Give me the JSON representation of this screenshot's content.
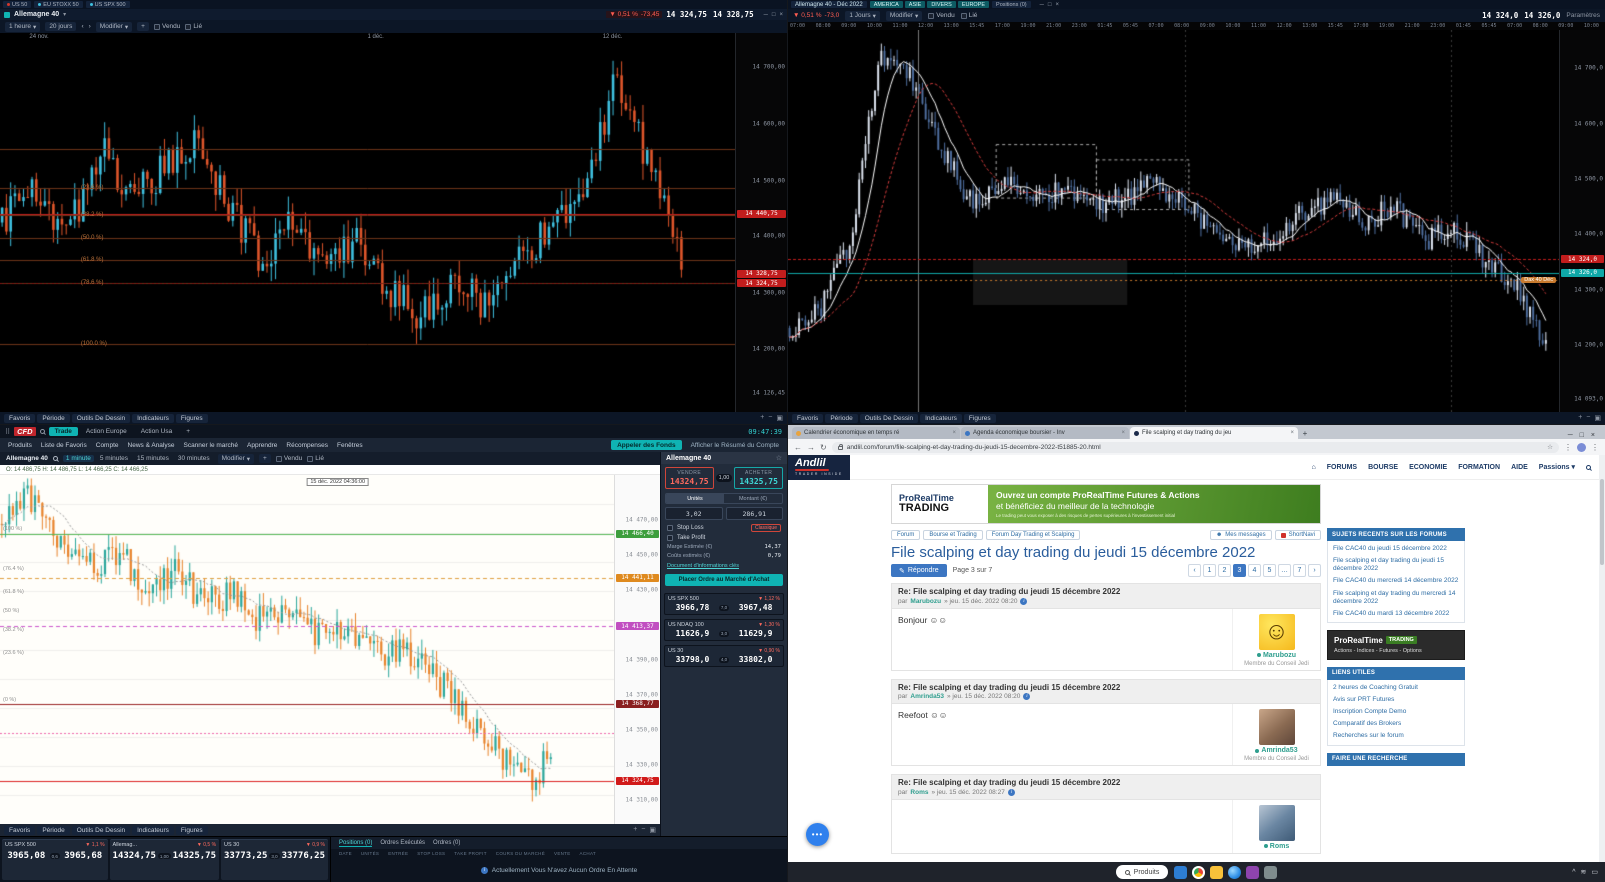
{
  "tl": {
    "workspace_tabs": [
      {
        "label": "US 50"
      },
      {
        "label": "EU STOXX 50"
      },
      {
        "label": "US SPX 500"
      }
    ],
    "title": "Allemagne 40",
    "change_pct": "▼ 0,51 %",
    "change_abs": "-73,45",
    "bid": "14 324,75",
    "ask": "14 328,75",
    "toolbar": {
      "timeframe": "1 heure",
      "range": "20 jours",
      "modify": "Modifier",
      "plus": "+",
      "sell": "Vendu",
      "link": "Lié"
    },
    "dates": [
      {
        "t": "24 nov.",
        "f": 0.04
      },
      {
        "t": "1 déc.",
        "f": 0.5
      },
      {
        "t": "12 déc.",
        "f": 0.82
      }
    ],
    "axis": [
      {
        "t": "14 700,00",
        "f": 0.09
      },
      {
        "t": "14 600,00",
        "f": 0.24
      },
      {
        "t": "14 500,00",
        "f": 0.39
      },
      {
        "t": "14 400,00",
        "f": 0.535
      },
      {
        "t": "14 300,00",
        "f": 0.685
      },
      {
        "t": "14 200,00",
        "f": 0.835
      },
      {
        "t": "14 126,45",
        "f": 0.95
      }
    ],
    "markers": [
      {
        "t": "14 440,75",
        "f": 0.477,
        "color": "#c21d1d"
      },
      {
        "t": "14 328,75",
        "f": 0.635,
        "color": "#c21d1d"
      },
      {
        "t": "14 324,75",
        "f": 0.66,
        "color": "#c21d1d"
      }
    ],
    "fibs": [
      {
        "t": "(23.6 %)",
        "f": 0.41
      },
      {
        "t": "(38.2 %)",
        "f": 0.48
      },
      {
        "t": "(50.0 %)",
        "f": 0.54
      },
      {
        "t": "(61.8 %)",
        "f": 0.6
      },
      {
        "t": "(78.6 %)",
        "f": 0.66
      },
      {
        "t": "(100.0 %)",
        "f": 0.82
      }
    ],
    "bottom_tabs": [
      "Favoris",
      "Période",
      "Outils De Dessin",
      "Indicateurs",
      "Figures"
    ]
  },
  "tr": {
    "title": "Allemagne 40 - Déc 2022",
    "groups": [
      "AMERICA",
      "ASIE",
      "DIVERS",
      "EUROPE"
    ],
    "positions": "Positions (0)",
    "change_pct": "▼ 0,51 %",
    "change_abs": "-73,0",
    "timeframe": "1 Jours",
    "modify": "Modifier",
    "sell": "Vendu",
    "link": "Lié",
    "bid": "14 324,0",
    "ask": "14 326,0",
    "settings": "Paramètres",
    "times": [
      "07:00",
      "08:00",
      "09:00",
      "10:00",
      "11:00",
      "12:00",
      "13:00",
      "15:45",
      "17:00",
      "19:00",
      "21:00",
      "23:00",
      "01:45",
      "05:45",
      "07:00",
      "08:00",
      "09:00",
      "10:00",
      "11:00",
      "12:00",
      "13:00",
      "15:45",
      "17:00",
      "19:00",
      "21:00",
      "23:00",
      "01:45",
      "05:45",
      "07:00",
      "08:00",
      "09:00",
      "10:00"
    ],
    "axis": [
      {
        "t": "14 700,0",
        "f": 0.1
      },
      {
        "t": "14 600,0",
        "f": 0.245
      },
      {
        "t": "14 500,0",
        "f": 0.39
      },
      {
        "t": "14 400,0",
        "f": 0.535
      },
      {
        "t": "14 300,0",
        "f": 0.68
      },
      {
        "t": "14 200,0",
        "f": 0.825
      },
      {
        "t": "14 093,0",
        "f": 0.965
      }
    ],
    "markers": [
      {
        "t": "14 324,0",
        "f": 0.6,
        "color": "#c21d1d"
      },
      {
        "t": "14 326,0",
        "f": 0.635,
        "color": "#0fa8a8"
      }
    ],
    "tag": {
      "t": "Dax 40 Déc",
      "f": 0.655
    },
    "bottom_tabs": [
      "Favoris",
      "Période",
      "Outils De Dessin",
      "Indicateurs",
      "Figures"
    ]
  },
  "bl": {
    "brand": "CFD",
    "clock": "09:47:39",
    "tabs": [
      {
        "label": "Trade",
        "active": true
      },
      {
        "label": "Action Europe"
      },
      {
        "label": "Action Usa"
      },
      {
        "label": "+"
      }
    ],
    "menu": [
      "Produits",
      "Liste de Favoris",
      "Compte",
      "News & Analyse",
      "Scanner le marché",
      "Apprendre",
      "Récompenses",
      "Fenêtres"
    ],
    "fund_btn": "Appeler des Fonds",
    "account_link": "Afficher le Résumé du Compte",
    "instrument": "Allemagne 40",
    "timeframes": [
      "1 minute",
      "5 minutes",
      "15 minutes",
      "30 minutes"
    ],
    "toolbar": {
      "modify": "Modifier",
      "plus": "+",
      "sell": "Vendu",
      "link": "Lié"
    },
    "ohlc": "O: 14 486,75   H: 14 486,75   L: 14 466,25   C: 14 466,25",
    "chart_date": "15 déc. 2022 04:36:00",
    "fibs": [
      {
        "t": "(100 %)",
        "f": 0.155
      },
      {
        "t": "(76.4 %)",
        "f": 0.27
      },
      {
        "t": "(61.8 %)",
        "f": 0.335
      },
      {
        "t": "(50 %)",
        "f": 0.39
      },
      {
        "t": "(38.2 %)",
        "f": 0.445
      },
      {
        "t": "(23.6 %)",
        "f": 0.51
      },
      {
        "t": "(0 %)",
        "f": 0.645
      }
    ],
    "scale": [
      {
        "t": "14 470,00",
        "f": 0.13
      },
      {
        "t": "14 450,00",
        "f": 0.23
      },
      {
        "t": "14 430,00",
        "f": 0.33
      },
      {
        "t": "14 410,00",
        "f": 0.43
      },
      {
        "t": "14 390,00",
        "f": 0.53
      },
      {
        "t": "14 370,00",
        "f": 0.63
      },
      {
        "t": "14 350,00",
        "f": 0.73
      },
      {
        "t": "14 330,00",
        "f": 0.83
      },
      {
        "t": "14 310,00",
        "f": 0.93
      }
    ],
    "markers": [
      {
        "t": "14 466,40",
        "f": 0.168,
        "color": "#3d9e3d"
      },
      {
        "t": "14 441,11",
        "f": 0.294,
        "color": "#df8a1f"
      },
      {
        "t": "14 413,37",
        "f": 0.433,
        "color": "#c14fc1"
      },
      {
        "t": "14 368,77",
        "f": 0.656,
        "color": "#8a1f1f"
      },
      {
        "t": "14 324,75",
        "f": 0.876,
        "color": "#d11a1a"
      }
    ],
    "order": {
      "title": "Allemagne 40",
      "sell_label": "VENDRE",
      "buy_label": "ACHETER",
      "sell": "14324,75",
      "buy": "14325,75",
      "spread": "1,00",
      "unit_tabs": [
        "Unités",
        "Montant (€)"
      ],
      "qty": "3,02",
      "notional": "286,91",
      "stop_loss": "Stop Loss",
      "sl_mode": "Classique",
      "take_profit": "Take Profit",
      "margin_label": "Marge Estimée (€)",
      "margin": "14,37",
      "costs_label": "Coûts estimés (€)",
      "costs": "0,79",
      "kid": "Document d'informations clés",
      "cta": "Placer Ordre au Marché d'Achat"
    },
    "panel_tiles": [
      {
        "name": "US SPX 500",
        "pct": "▼ 1,12 %",
        "spread": "7,0",
        "sell": "3966,78",
        "buy": "3967,48"
      },
      {
        "name": "US NDAQ 100",
        "pct": "▼ 1,30 %",
        "spread": "3,0",
        "sell": "11626,9",
        "buy": "11629,9"
      },
      {
        "name": "US 30",
        "pct": "▼ 0,90 %",
        "spread": "4,0",
        "sell": "33798,0",
        "buy": "33802,0"
      }
    ],
    "bottom_tiles": [
      {
        "name": "US SPX 500",
        "pct": "▼ 1,1 %",
        "spread": "0,6",
        "sell": "3965,08",
        "buy": "3965,68"
      },
      {
        "name": "Allemag...",
        "pct": "▼ 0,5 %",
        "spread": "1,00",
        "sell": "14324,75",
        "buy": "14325,75"
      },
      {
        "name": "US 30",
        "pct": "▼ 0,9 %",
        "spread": "3,0",
        "sell": "33773,25",
        "buy": "33776,25"
      }
    ],
    "positions": {
      "tabs": [
        "Positions (0)",
        "Ordres Exécutés",
        "Ordres (0)"
      ],
      "headers": [
        "DATE",
        "UNITÉS",
        "ENTRÉE",
        "STOP LOSS",
        "TAKE PROFIT",
        "COURS DU MARCHÉ",
        "VENTE",
        "ACHAT"
      ],
      "empty": "Actuellement Vous N'avez Aucun Ordre En Attente"
    },
    "bottom_tabs": [
      "Favoris",
      "Période",
      "Outils De Dessin",
      "Indicateurs",
      "Figures"
    ]
  },
  "br": {
    "tabs": [
      {
        "title": "Calendrier économique en temps ré",
        "color": "#e8a33d"
      },
      {
        "title": "Agenda économique boursier - Inv",
        "color": "#3c76c2"
      },
      {
        "title": "File scalping et day trading du jeu",
        "color": "#1b2a4a",
        "active": true
      }
    ],
    "url": "andlil.com/forum/file-scalping-et-day-trading-du-jeudi-15-decembre-2022-t51885-20.html",
    "brand": {
      "name": "Andlil",
      "sub": "TRADER INSIDE"
    },
    "nav": [
      "FORUMS",
      "BOURSE",
      "ECONOMIE",
      "FORMATION",
      "AIDE",
      "Passions ▾"
    ],
    "banner": {
      "logo1": "ProRealTime",
      "logo2": "TRADING",
      "line1": "Ouvrez un compte ProRealTime Futures & Actions",
      "line2": "et bénéficiez du meilleur de la technologie",
      "disclaimer": "Le trading peut vous exposer à des risques de pertes supérieures à l'investissement initial"
    },
    "crumbs": [
      "Forum",
      "Bourse et Trading",
      "Forum Day Trading et Scalping"
    ],
    "crumb_right": [
      "Mes messages",
      "ShortNavi"
    ],
    "h1": "File scalping et day trading du jeudi 15 décembre 2022",
    "reply": "Répondre",
    "page_info": "Page 3 sur 7",
    "pages": [
      "1",
      "2",
      "3",
      "4",
      "5",
      "…",
      "7"
    ],
    "current_page": "3",
    "posts": [
      {
        "title": "Re: File scalping et day trading du jeudi 15 décembre 2022",
        "by": "par",
        "author": "Marubozu",
        "date": "» jeu. 15 déc. 2022 08:20",
        "body": "Bonjour ☺☺",
        "rank": "Membre du Conseil Jedi",
        "avatar": "smiley"
      },
      {
        "title": "Re: File scalping et day trading du jeudi 15 décembre 2022",
        "by": "par",
        "author": "Amrinda53",
        "date": "» jeu. 15 déc. 2022 08:20",
        "body": "Reefoot ☺☺",
        "rank": "Membre du Conseil Jedi",
        "avatar": "photo"
      },
      {
        "title": "Re: File scalping et day trading du jeudi 15 décembre 2022",
        "by": "par",
        "author": "Roms",
        "date": "» jeu. 15 déc. 2022 08:27",
        "body": "",
        "rank": "",
        "avatar": "cars"
      }
    ],
    "sidebar": {
      "recents_title": "SUJETS RECENTS SUR LES FORUMS",
      "recents": [
        "File CAC40 du jeudi 15 décembre 2022",
        "File scalping et day trading du jeudi 15 décembre 2022",
        "File CAC40 du mercredi 14 décembre 2022",
        "File scalping et day trading du mercredi 14 décembre 2022",
        "File CAC40 du mardi 13 décembre 2022"
      ],
      "prt": {
        "logo1": "ProRealTime",
        "logo2": "TRADING",
        "line": "Actions - Indices - Futures - Options"
      },
      "liens_title": "LIENS UTILES",
      "liens": [
        "2 heures de Coaching Gratuit",
        "Avis sur PRT Futures",
        "Inscription Compte Demo",
        "Comparatif des Brokers",
        "Recherches sur le forum"
      ],
      "search_title": "FAIRE UNE RECHERCHE"
    }
  },
  "taskbar": {
    "search": "Produits",
    "apps": [
      "store",
      "chrome",
      "folder",
      "edge",
      "media",
      "settings"
    ],
    "tray": [
      "chevron-up",
      "network",
      "battery"
    ]
  },
  "charts": {
    "tl": {
      "id": "cv-tl",
      "bg": "#000000",
      "up": "#3fc1e0",
      "down": "#e0562b",
      "n": 160,
      "seed": 11,
      "noise": 0.05,
      "span": 0.93,
      "way": [
        0.5,
        0.42,
        0.55,
        0.3,
        0.45,
        0.35,
        0.28,
        0.45,
        0.6,
        0.5,
        0.62,
        0.55,
        0.68,
        0.75,
        0.65,
        0.72,
        0.6,
        0.52,
        0.45,
        0.1,
        0.35,
        0.62
      ],
      "hlines": [
        {
          "f": 0.305,
          "color": "#6e3418",
          "w": 1
        },
        {
          "f": 0.41,
          "color": "#6e3418",
          "w": 1
        },
        {
          "f": 0.48,
          "color": "#6e3418",
          "w": 1
        },
        {
          "f": 0.54,
          "color": "#6e3418",
          "w": 1
        },
        {
          "f": 0.6,
          "color": "#6e3418",
          "w": 1
        },
        {
          "f": 0.66,
          "color": "#6e3418",
          "w": 1
        },
        {
          "f": 0.82,
          "color": "#6e3418",
          "w": 1
        },
        {
          "f": 0.477,
          "color": "#c21d1d",
          "w": 1
        },
        {
          "f": 0.66,
          "color": "#8a1414",
          "w": 1,
          "dash": [
            2,
            2
          ]
        }
      ]
    },
    "tr": {
      "id": "cv-tr",
      "bg": "#000000",
      "up": "#dfe6f2",
      "down": "#4f6fa0",
      "n": 240,
      "seed": 5,
      "noise": 0.03,
      "span": 0.985,
      "way": [
        0.78,
        0.74,
        0.55,
        0.06,
        0.12,
        0.3,
        0.45,
        0.4,
        0.44,
        0.42,
        0.46,
        0.44,
        0.4,
        0.46,
        0.52,
        0.58,
        0.54,
        0.48,
        0.44,
        0.5,
        0.46,
        0.55,
        0.52,
        0.6,
        0.66,
        0.84
      ],
      "ma": [
        {
          "p": 9,
          "color": "#ffffff"
        },
        {
          "p": 21,
          "color": "#d23c3c",
          "dash": [
            3,
            2
          ]
        }
      ],
      "vlines": [
        {
          "x": 0.168,
          "color": "#777777"
        },
        {
          "x": 0.515,
          "color": "#3a3a3a",
          "dash": [
            2,
            3
          ]
        },
        {
          "x": 0.86,
          "color": "#3a3a3a",
          "dash": [
            2,
            3
          ]
        }
      ],
      "boxes": [
        {
          "x0": 0.27,
          "x1": 0.4,
          "y0": 0.3,
          "y1": 0.44,
          "stroke": "#aaaaaa"
        },
        {
          "x0": 0.4,
          "x1": 0.52,
          "y0": 0.34,
          "y1": 0.47,
          "stroke": "#aaaaaa"
        },
        {
          "x0": 0.24,
          "x1": 0.44,
          "y0": 0.6,
          "y1": 0.72,
          "fill": "#161616"
        }
      ],
      "hlines": [
        {
          "f": 0.6,
          "color": "#c21d1d",
          "w": 1,
          "dash": [
            3,
            2
          ]
        },
        {
          "f": 0.635,
          "color": "#0fa8a8",
          "w": 1
        },
        {
          "f": 0.655,
          "color": "#c87a2e",
          "w": 1,
          "dash": [
            2,
            3
          ],
          "x0": 0.1
        }
      ]
    },
    "bl": {
      "id": "cv-bl",
      "bg": "#fffefa",
      "up": "#2aa79b",
      "down": "#e8842c",
      "n": 150,
      "seed": 23,
      "noise": 0.045,
      "span": 0.9,
      "way": [
        0.14,
        0.06,
        0.18,
        0.26,
        0.22,
        0.32,
        0.28,
        0.36,
        0.34,
        0.42,
        0.38,
        0.46,
        0.44,
        0.52,
        0.5,
        0.58,
        0.66,
        0.78,
        0.88,
        0.82
      ],
      "ma": [
        {
          "p": 12,
          "color": "#9a9a9a",
          "dash": [
            2,
            2
          ]
        }
      ],
      "grid": {
        "color": "#efefec",
        "rows": 12
      },
      "hlines": [
        {
          "f": 0.168,
          "color": "#57b957",
          "w": 1
        },
        {
          "f": 0.294,
          "color": "#e0a040",
          "w": 1,
          "dash": [
            4,
            3
          ]
        },
        {
          "f": 0.433,
          "color": "#cc55cc",
          "w": 1,
          "dash": [
            4,
            3
          ]
        },
        {
          "f": 0.656,
          "color": "#992222",
          "w": 1
        },
        {
          "f": 0.74,
          "color": "#ee66aa",
          "w": 1,
          "dash": [
            2,
            2
          ]
        },
        {
          "f": 0.876,
          "color": "#dd2222",
          "w": 1
        }
      ]
    }
  }
}
